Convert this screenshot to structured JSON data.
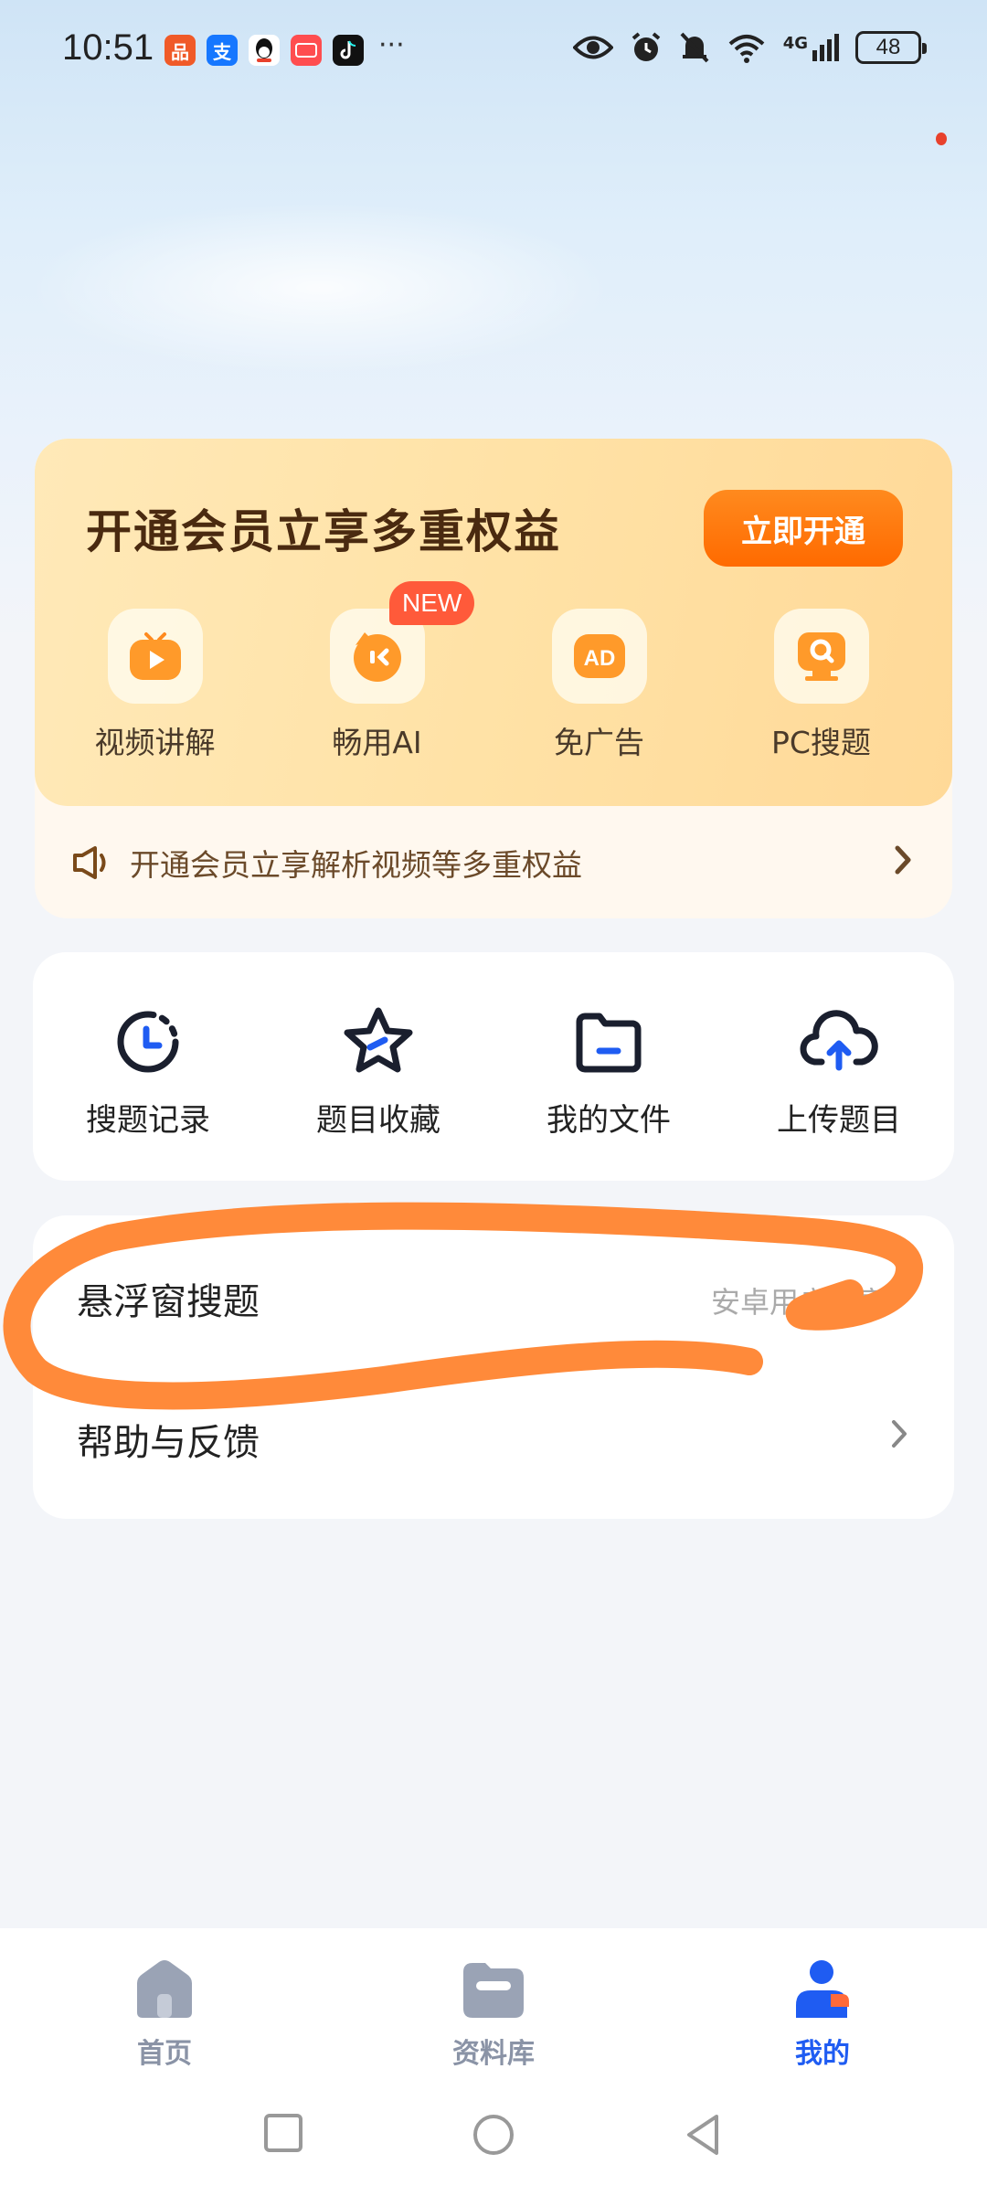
{
  "status_bar": {
    "time": "10:51",
    "battery": "48",
    "network": "4G",
    "more": "···"
  },
  "colors": {
    "accent": "#1f5cf2",
    "vip_orange": "#ff6a00",
    "vip_text": "#4a2a10",
    "scribble": "#ff8a3a"
  },
  "vip": {
    "title": "开通会员立享多重权益",
    "button": "立即开通",
    "benefits": [
      {
        "label": "视频讲解",
        "icon": "video-play-icon"
      },
      {
        "label": "畅用AI",
        "icon": "ai-face-icon",
        "badge": "NEW"
      },
      {
        "label": "免广告",
        "icon": "ad-icon",
        "icon_text": "AD"
      },
      {
        "label": "PC搜题",
        "icon": "pc-search-icon"
      }
    ],
    "notice": "开通会员立享解析视频等多重权益"
  },
  "tools": [
    {
      "label": "搜题记录",
      "icon": "clock-icon"
    },
    {
      "label": "题目收藏",
      "icon": "star-icon"
    },
    {
      "label": "我的文件",
      "icon": "folder-icon"
    },
    {
      "label": "上传题目",
      "icon": "cloud-upload-icon"
    }
  ],
  "settings": {
    "floating": {
      "title": "悬浮窗搜题",
      "sub": "安卓用户专享"
    },
    "help": {
      "title": "帮助与反馈"
    }
  },
  "bottom_nav": [
    {
      "label": "首页",
      "icon": "home-icon"
    },
    {
      "label": "资料库",
      "icon": "library-icon"
    },
    {
      "label": "我的",
      "icon": "profile-icon",
      "active": true
    }
  ]
}
